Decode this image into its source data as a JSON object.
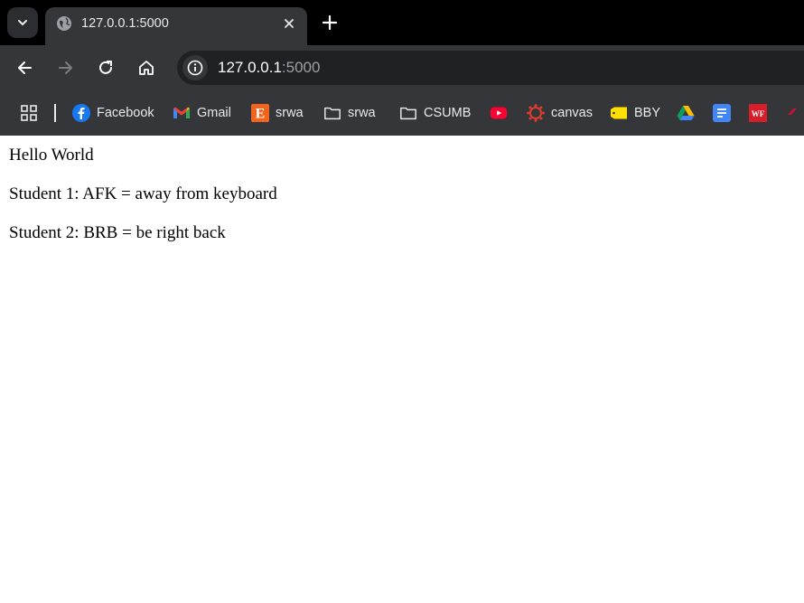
{
  "browser": {
    "tab": {
      "title": "127.0.0.1:5000"
    },
    "address": {
      "host": "127.0.0.1",
      "port": ":5000"
    },
    "bookmarks": [
      {
        "label": "Facebook",
        "icon": "facebook-icon"
      },
      {
        "label": "Gmail",
        "icon": "gmail-icon"
      },
      {
        "label": "srwa",
        "icon": "etsy-icon"
      },
      {
        "label": "srwa",
        "icon": "folder-icon"
      },
      {
        "label": "CSUMB",
        "icon": "folder-icon"
      },
      {
        "label": "",
        "icon": "youtube-icon"
      },
      {
        "label": "canvas",
        "icon": "canvas-icon"
      },
      {
        "label": "BBY",
        "icon": "bestbuy-icon"
      },
      {
        "label": "",
        "icon": "google-drive-icon"
      },
      {
        "label": "",
        "icon": "google-docs-icon"
      },
      {
        "label": "",
        "icon": "wf-icon"
      }
    ],
    "wf_text": "WF"
  },
  "page": {
    "line1": "Hello World",
    "line2": "Student 1: AFK = away from keyboard",
    "line3": "Student 2: BRB = be right back"
  }
}
